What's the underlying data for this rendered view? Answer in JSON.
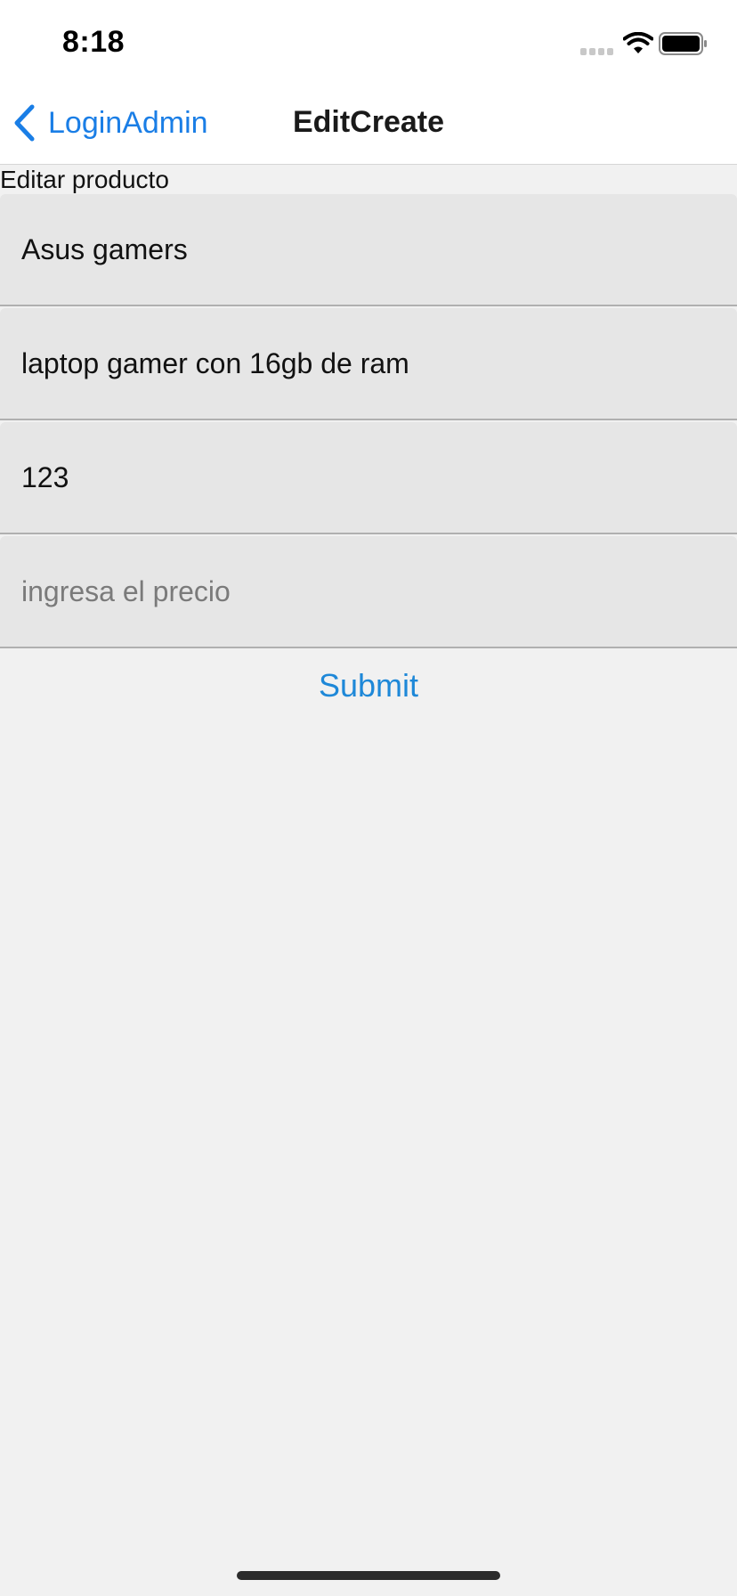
{
  "status_bar": {
    "time": "8:18",
    "icons": [
      "signal-dots-icon",
      "wifi-icon",
      "battery-icon"
    ]
  },
  "nav": {
    "back_label": "LoginAdmin",
    "title": "EditCreate",
    "accent_color": "#1a7ee6"
  },
  "page": {
    "heading": "Editar producto"
  },
  "form": {
    "fields": [
      {
        "value": "Asus gamers",
        "placeholder": ""
      },
      {
        "value": "laptop gamer con 16gb de ram",
        "placeholder": ""
      },
      {
        "value": "123",
        "placeholder": ""
      },
      {
        "value": "",
        "placeholder": "ingresa el precio"
      }
    ],
    "submit_label": "Submit",
    "submit_color": "#1e88d8"
  }
}
